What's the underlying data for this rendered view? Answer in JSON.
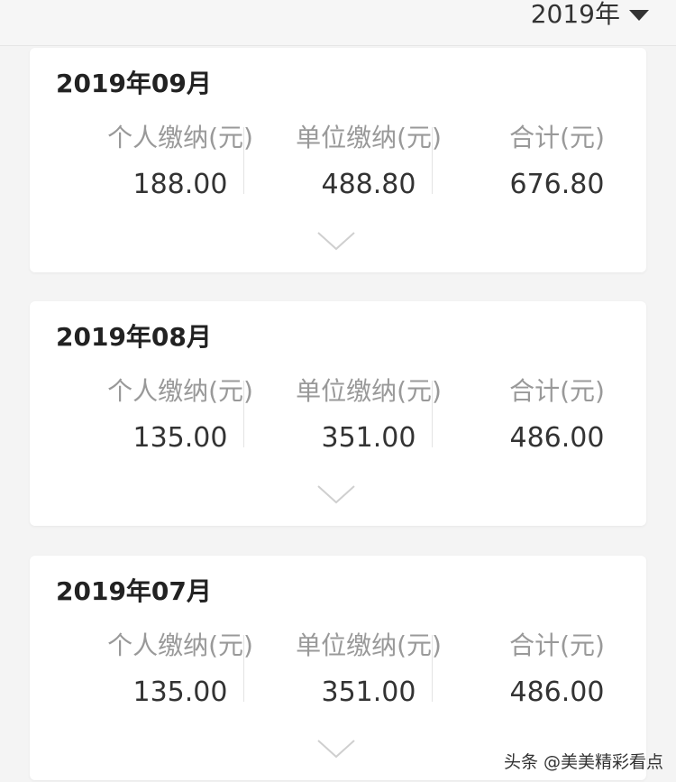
{
  "header": {
    "year": "2019年"
  },
  "cards": [
    {
      "month": "2019年09月",
      "personal_label": "个人缴纳(元)",
      "personal_value": "188.00",
      "employer_label": "单位缴纳(元)",
      "employer_value": "488.80",
      "total_label": "合计(元)",
      "total_value": "676.80"
    },
    {
      "month": "2019年08月",
      "personal_label": "个人缴纳(元)",
      "personal_value": "135.00",
      "employer_label": "单位缴纳(元)",
      "employer_value": "351.00",
      "total_label": "合计(元)",
      "total_value": "486.00"
    },
    {
      "month": "2019年07月",
      "personal_label": "个人缴纳(元)",
      "personal_value": "135.00",
      "employer_label": "单位缴纳(元)",
      "employer_value": "351.00",
      "total_label": "合计(元)",
      "total_value": "486.00"
    }
  ],
  "watermark": "头条 @美美精彩看点",
  "colors": {
    "background": "#f4f4f4",
    "card": "#ffffff",
    "label": "#999999",
    "value": "#333333"
  },
  "icons": {
    "year_dropdown": "triangle-down-icon",
    "expand": "chevron-down-icon"
  }
}
